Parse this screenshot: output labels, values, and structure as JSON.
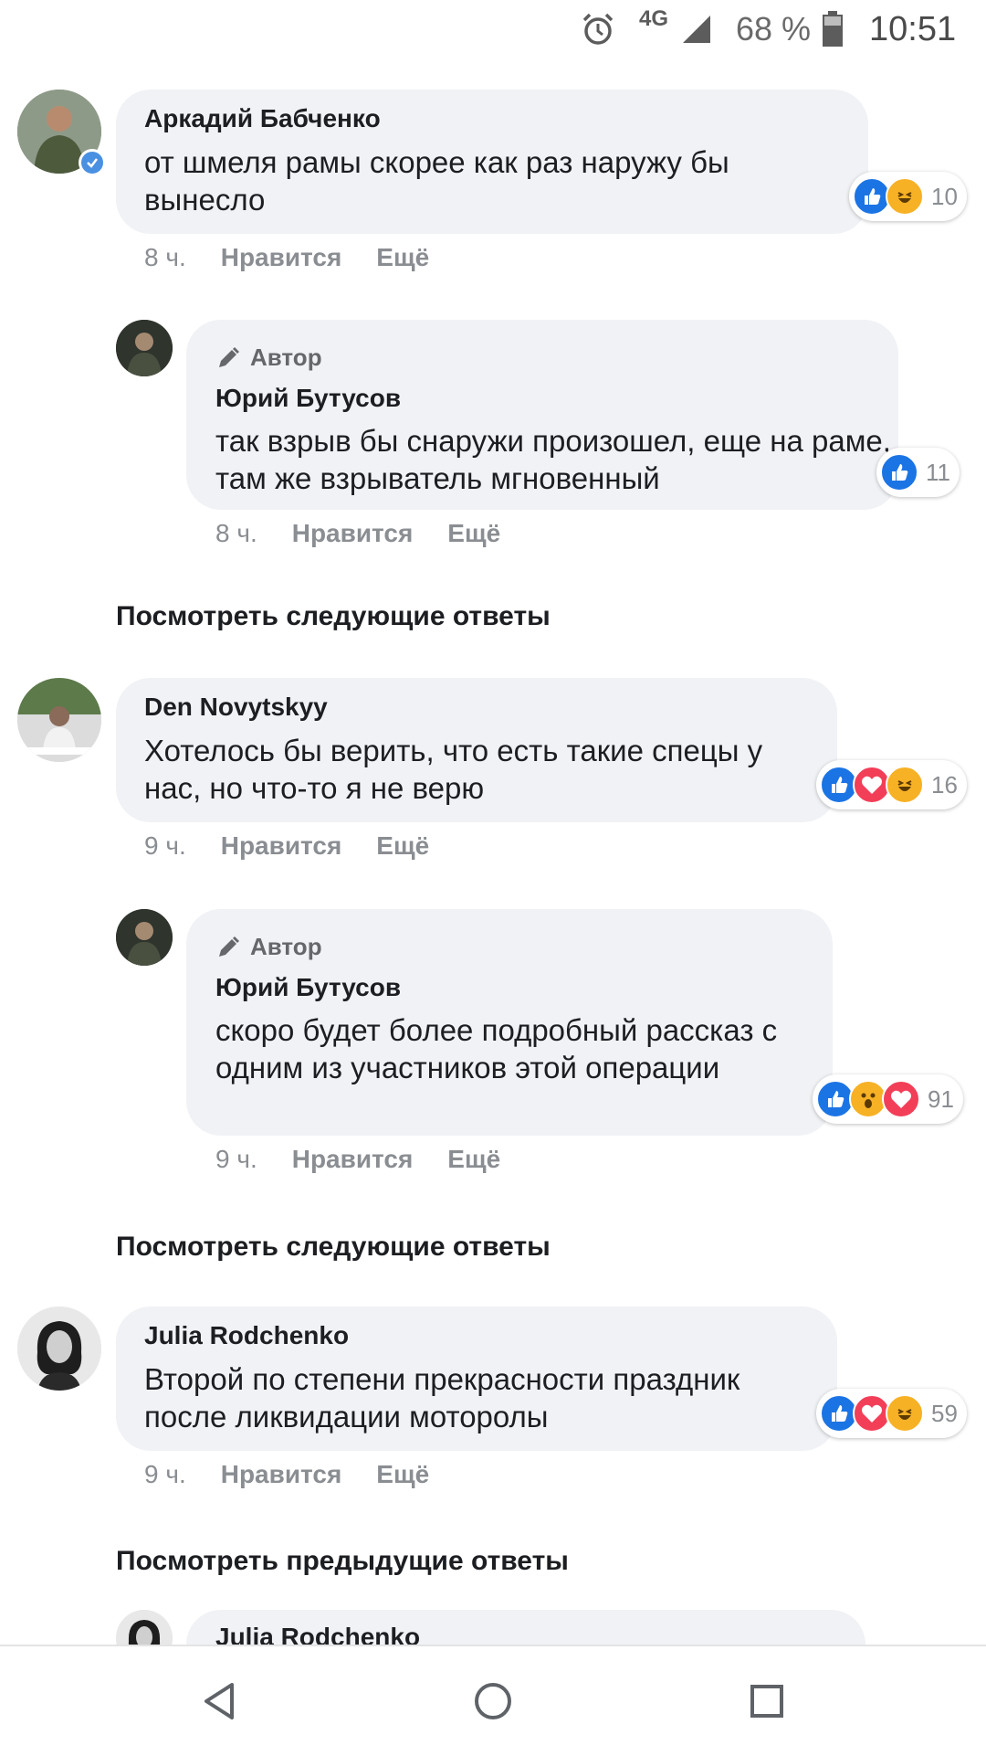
{
  "status_bar": {
    "network": "4G",
    "battery_percent": "68 %",
    "time": "10:51",
    "icons": [
      "alarm-icon",
      "signal-icon",
      "battery-icon"
    ]
  },
  "comments": [
    {
      "name": "Аркадий Бабченко",
      "text": "от шмеля рамы скорее как раз наружу бы вынесло",
      "time": "8 ч.",
      "like_label": "Нравится",
      "more_label": "Ещё",
      "reaction_count": "10",
      "reactions": [
        "like",
        "haha"
      ],
      "verified": true
    },
    {
      "author_tag": "Автор",
      "name": "Юрий Бутусов",
      "text": "так взрыв бы снаружи произошел, еще на раме, там же взрыватель мгновенный",
      "time": "8 ч.",
      "like_label": "Нравится",
      "more_label": "Ещё",
      "reaction_count": "11",
      "reactions": [
        "like"
      ]
    },
    {
      "name": "Den Novytskyy",
      "text": "Хотелось бы верить, что есть такие спецы у нас, но что-то я не верю",
      "time": "9 ч.",
      "like_label": "Нравится",
      "more_label": "Ещё",
      "reaction_count": "16",
      "reactions": [
        "like",
        "love",
        "haha"
      ]
    },
    {
      "author_tag": "Автор",
      "name": "Юрий Бутусов",
      "text": "скоро будет более подробный рассказ с одним из участников этой операции",
      "time": "9 ч.",
      "like_label": "Нравится",
      "more_label": "Ещё",
      "reaction_count": "91",
      "reactions": [
        "like",
        "wow",
        "love"
      ]
    },
    {
      "name": "Julia Rodchenko",
      "text": "Второй по степени прекрасности праздник после ликвидации моторолы",
      "time": "9 ч.",
      "like_label": "Нравится",
      "more_label": "Ещё",
      "reaction_count": "59",
      "reactions": [
        "like",
        "love",
        "haha"
      ]
    },
    {
      "name": "Julia Rodchenko"
    }
  ],
  "more_replies": [
    "Посмотреть следующие ответы",
    "Посмотреть следующие ответы",
    "Посмотреть предыдущие ответы"
  ],
  "nav_bar": [
    "back-icon",
    "home-icon",
    "recents-icon"
  ],
  "colors": {
    "bubble": "#f0f2f5",
    "like_blue": "#1b74e4",
    "love_red": "#f33e58",
    "haha_yellow": "#f7b125",
    "meta_gray": "#8a8d91"
  }
}
